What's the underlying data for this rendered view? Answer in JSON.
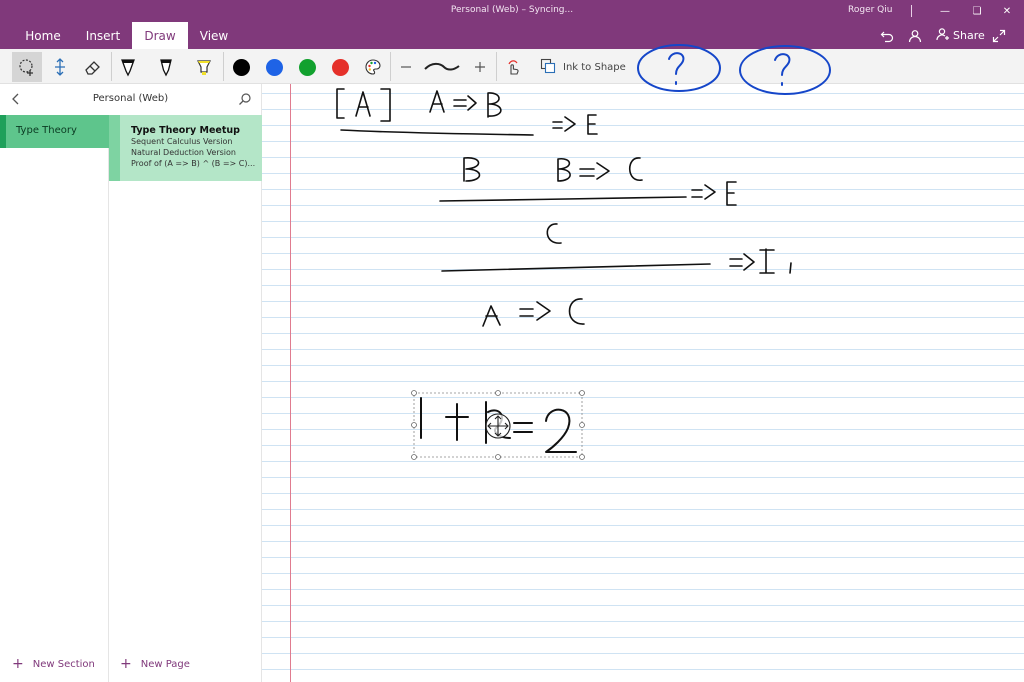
{
  "window": {
    "title": "Personal (Web) – Syncing...",
    "user": "Roger Qiu"
  },
  "ribbon": {
    "tabs": [
      {
        "label": "Home"
      },
      {
        "label": "Insert"
      },
      {
        "label": "Draw",
        "active": true
      },
      {
        "label": "View"
      }
    ],
    "share_label": "Share"
  },
  "toolbar": {
    "tools": [
      "lasso-select-icon",
      "add-space-icon",
      "eraser-icon",
      "pen-black-icon",
      "pen-icon",
      "highlighter-icon"
    ],
    "colors": [
      {
        "name": "black",
        "hex": "#000000"
      },
      {
        "name": "blue",
        "hex": "#1e63e6"
      },
      {
        "name": "green",
        "hex": "#12a12e"
      },
      {
        "name": "red",
        "hex": "#e5302a"
      }
    ],
    "ink_to_shape_label": "Ink to Shape",
    "accent": "#80397B"
  },
  "nav": {
    "notebook": "Personal (Web)",
    "sections": [
      {
        "label": "Type Theory",
        "color": "#5ec58c"
      }
    ],
    "pages": [
      {
        "title": "Type Theory Meetup",
        "preview": [
          "Sequent Calculus Version",
          "Natural Deduction Version",
          "Proof of (A => B) ^ (B => C)..."
        ]
      }
    ],
    "new_section_label": "New Section",
    "new_page_label": "New Page"
  }
}
